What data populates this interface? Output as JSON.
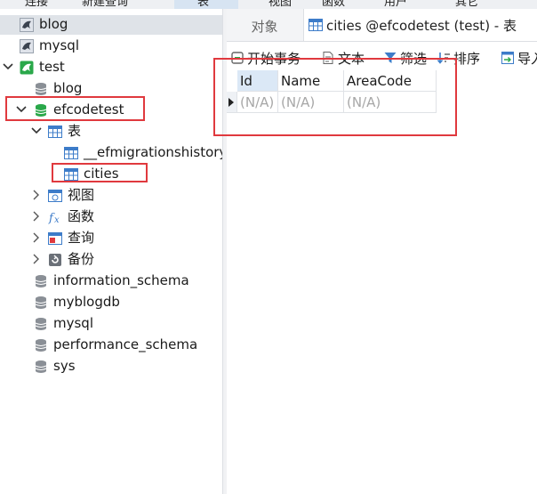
{
  "top_menu": [
    "连接",
    "新建查询",
    "表",
    "视图",
    "函数",
    "用户",
    "其它"
  ],
  "tree": {
    "blog_conn": "blog",
    "mysql_conn": "mysql",
    "test_conn": "test",
    "db_blog": "blog",
    "db_efcodetest": "efcodetest",
    "tables_folder": "表",
    "table_migrations": "__efmigrationshistory",
    "table_cities": "cities",
    "views_folder": "视图",
    "functions_folder": "函数",
    "queries_folder": "查询",
    "backups_folder": "备份",
    "db_information_schema": "information_schema",
    "db_myblogdb": "myblogdb",
    "db_mysql": "mysql",
    "db_performance_schema": "performance_schema",
    "db_sys": "sys"
  },
  "tabs": {
    "objects": "对象",
    "current": "cities @efcodetest (test) - 表"
  },
  "toolbar": {
    "begin_transaction": "开始事务",
    "text": "文本",
    "filter": "筛选",
    "sort": "排序",
    "import": "导入"
  },
  "grid": {
    "columns": [
      "Id",
      "Name",
      "AreaCode"
    ],
    "row": [
      "(N/A)",
      "(N/A)",
      "(N/A)"
    ]
  },
  "colors": {
    "highlight_red": "#e0393e",
    "db_green": "#2aa84a",
    "table_blue": "#3d7cc9"
  }
}
